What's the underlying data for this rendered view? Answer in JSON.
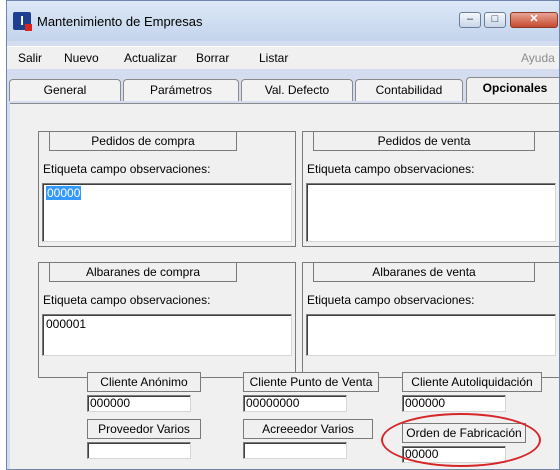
{
  "window": {
    "title": "Mantenimiento de Empresas",
    "controls": {
      "minimize": "–",
      "maximize": "□",
      "close": "✕"
    }
  },
  "menu": {
    "items": [
      {
        "label": "Salir"
      },
      {
        "label": "Nuevo"
      },
      {
        "label": "Actualizar"
      },
      {
        "label": "Borrar"
      },
      {
        "label": "Listar"
      },
      {
        "label": "Ayuda"
      }
    ]
  },
  "tabs": [
    {
      "label": "General"
    },
    {
      "label": "Parámetros"
    },
    {
      "label": "Val. Defecto"
    },
    {
      "label": "Contabilidad"
    },
    {
      "label": "Opcionales"
    }
  ],
  "groups": {
    "pedidos_compra": {
      "title": "Pedidos de compra",
      "label": "Etiqueta campo observaciones:",
      "value": "00000"
    },
    "pedidos_venta": {
      "title": "Pedidos de venta",
      "label": "Etiqueta campo observaciones:",
      "value": ""
    },
    "albaranes_compra": {
      "title": "Albaranes de compra",
      "label": "Etiqueta campo observaciones:",
      "value": "000001"
    },
    "albaranes_venta": {
      "title": "Albaranes de venta",
      "label": "Etiqueta campo observaciones:",
      "value": ""
    }
  },
  "fields": {
    "cliente_anonimo": {
      "label": "Cliente Anónimo",
      "value": "000000"
    },
    "cliente_punto_venta": {
      "label": "Cliente Punto de Venta",
      "value": "00000000"
    },
    "cliente_autoliquidacion": {
      "label": "Cliente Autoliquidación",
      "value": "000000"
    },
    "proveedor_varios": {
      "label": "Proveedor Varios",
      "value": ""
    },
    "acreedor_varios": {
      "label": "Acreeedor Varios",
      "value": ""
    },
    "orden_fabricacion": {
      "label": "Orden de Fabricación",
      "value": "00000"
    }
  },
  "colors": {
    "annotation": "#d6262a",
    "selection": "#3399ff"
  }
}
